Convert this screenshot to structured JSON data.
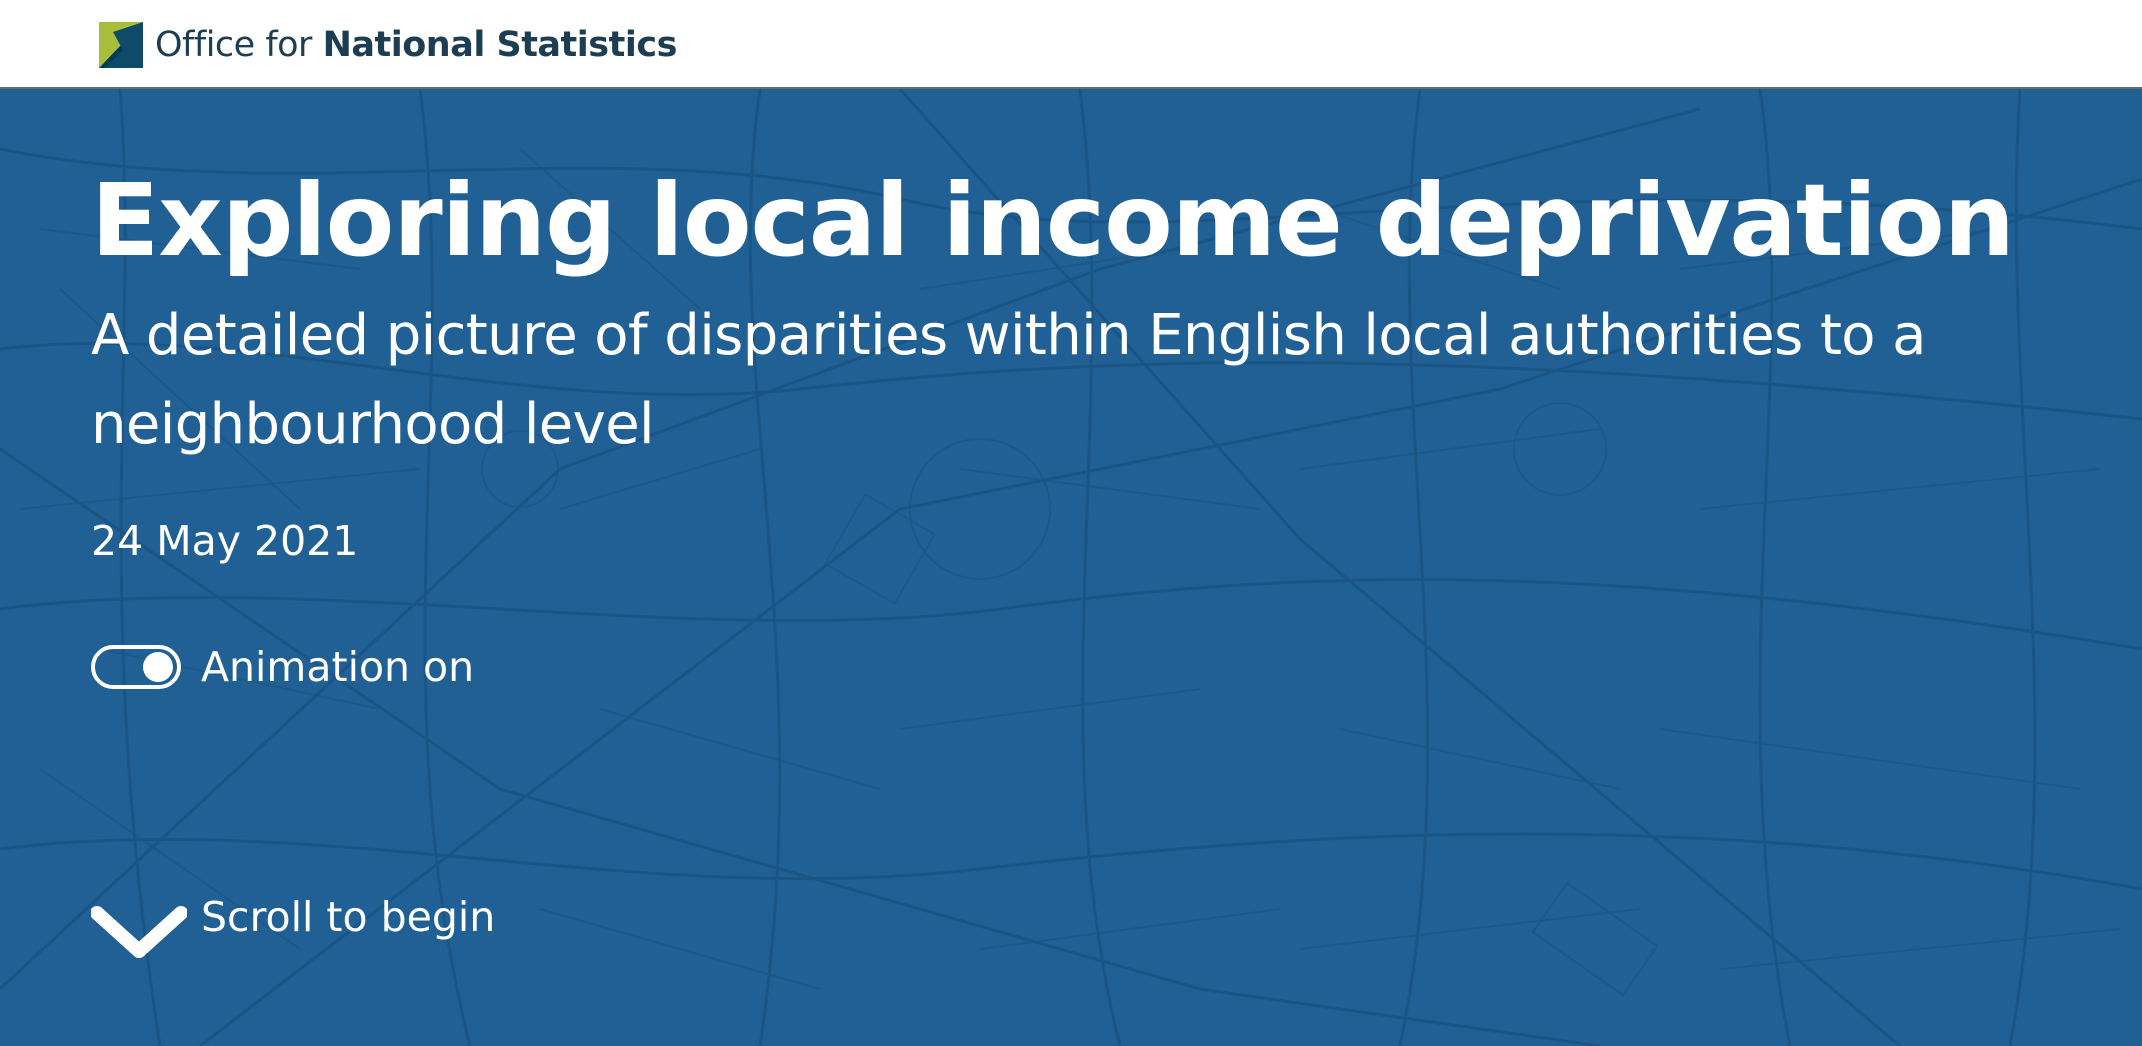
{
  "brand": {
    "name_light": "Office for",
    "name_bold": "National Statistics",
    "logo_icon": "ons-logo-icon",
    "colors": {
      "logo_green": "#a8bd3a",
      "logo_navy": "#003c57",
      "text": "#1d3e52"
    }
  },
  "hero": {
    "background_color": "#206095",
    "map_line_color": "#1b5585",
    "title": "Exploring local income deprivation",
    "subtitle": "A detailed picture of disparities within English local authorities to a neighbourhood level",
    "date": "24 May 2021",
    "animation_toggle": {
      "label": "Animation on",
      "state": "on"
    },
    "scroll_prompt": {
      "label": "Scroll to begin",
      "icon": "chevron-down-icon"
    }
  }
}
